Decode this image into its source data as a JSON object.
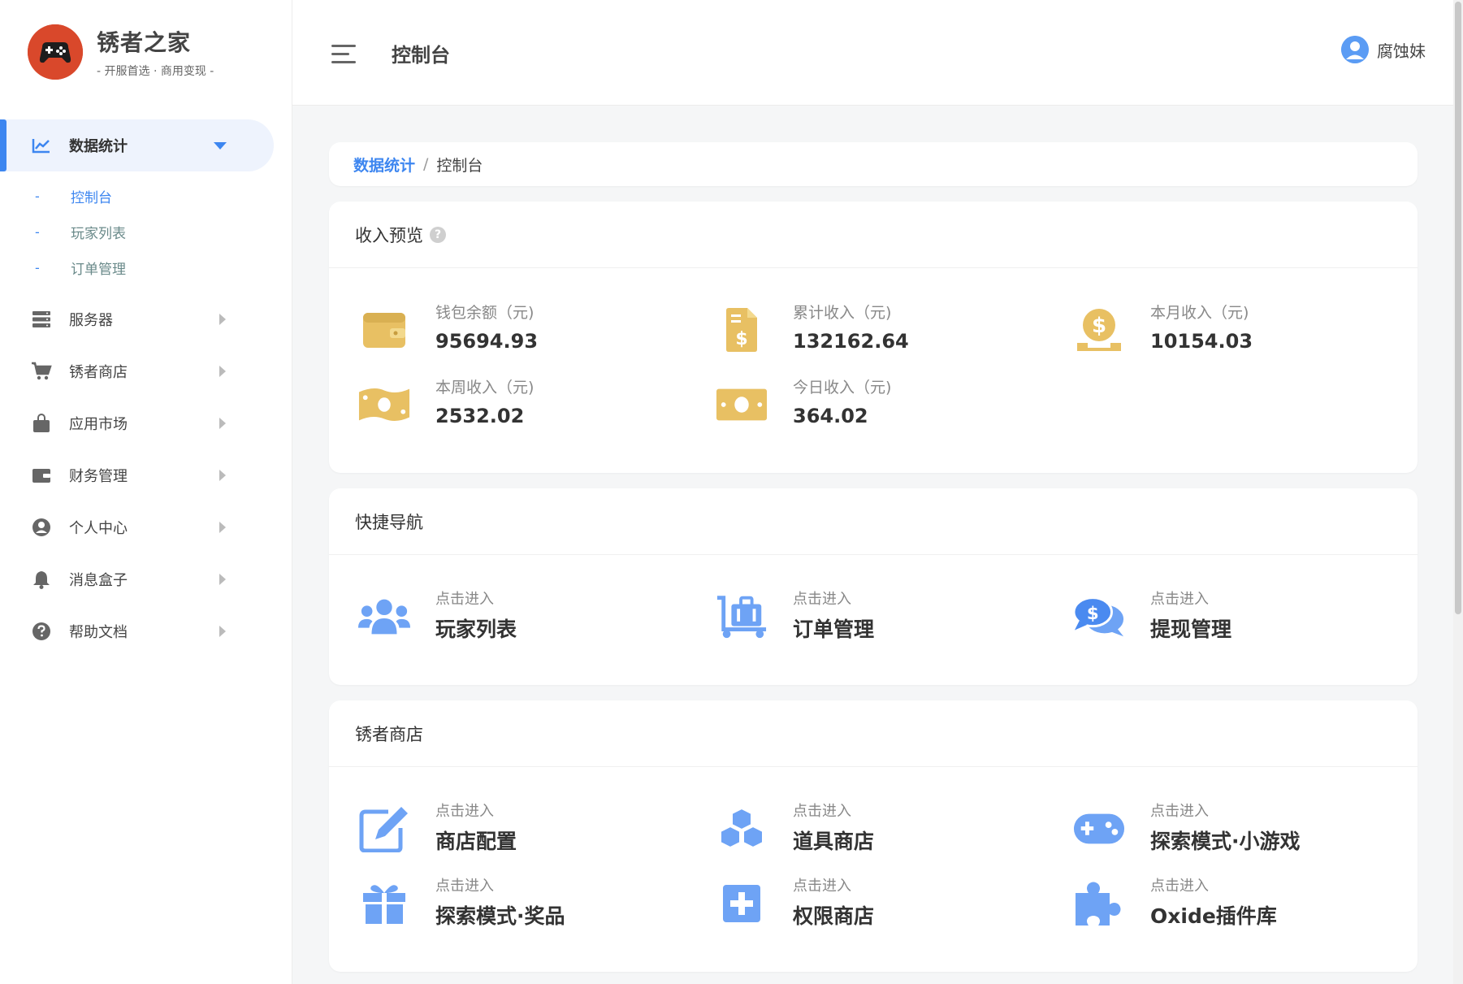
{
  "brand": {
    "title": "锈者之家",
    "subtitle": "- 开服首选 · 商用变现 -"
  },
  "header": {
    "title": "控制台",
    "user_name": "腐蚀妹"
  },
  "sidebar": {
    "active_group": "数据统计",
    "sub_items": [
      "控制台",
      "玩家列表",
      "订单管理"
    ],
    "items": [
      "服务器",
      "锈者商店",
      "应用市场",
      "财务管理",
      "个人中心",
      "消息盒子",
      "帮助文档"
    ]
  },
  "breadcrumb": {
    "parent": "数据统计",
    "separator": "/",
    "current": "控制台"
  },
  "income": {
    "title": "收入预览",
    "help": "?",
    "stats": [
      {
        "label": "钱包余额（元)",
        "value": "95694.93",
        "icon": "wallet-icon"
      },
      {
        "label": "累计收入（元)",
        "value": "132162.64",
        "icon": "invoice-dollar-icon"
      },
      {
        "label": "本月收入（元)",
        "value": "10154.03",
        "icon": "hand-coin-icon"
      },
      {
        "label": "本周收入（元)",
        "value": "2532.02",
        "icon": "money-bill-wave-icon"
      },
      {
        "label": "今日收入（元)",
        "value": "364.02",
        "icon": "money-bill-icon"
      }
    ]
  },
  "quick_nav": {
    "title": "快捷导航",
    "items": [
      {
        "hint": "点击进入",
        "title": "玩家列表",
        "icon": "users-icon"
      },
      {
        "hint": "点击进入",
        "title": "订单管理",
        "icon": "dolly-icon"
      },
      {
        "hint": "点击进入",
        "title": "提现管理",
        "icon": "comments-dollar-icon"
      }
    ]
  },
  "shop": {
    "title": "锈者商店",
    "items": [
      {
        "hint": "点击进入",
        "title": "商店配置",
        "icon": "edit-icon"
      },
      {
        "hint": "点击进入",
        "title": "道具商店",
        "icon": "cubes-icon"
      },
      {
        "hint": "点击进入",
        "title": "探索模式·小游戏",
        "icon": "gamepad-icon"
      },
      {
        "hint": "点击进入",
        "title": "探索模式·奖品",
        "icon": "gift-icon"
      },
      {
        "hint": "点击进入",
        "title": "权限商店",
        "icon": "plus-square-icon"
      },
      {
        "hint": "点击进入",
        "title": "Oxide插件库",
        "icon": "puzzle-icon"
      }
    ]
  },
  "colors": {
    "accent": "#3d86f0",
    "gold": "#e8c063",
    "icon_blue": "#6ea3f5"
  }
}
